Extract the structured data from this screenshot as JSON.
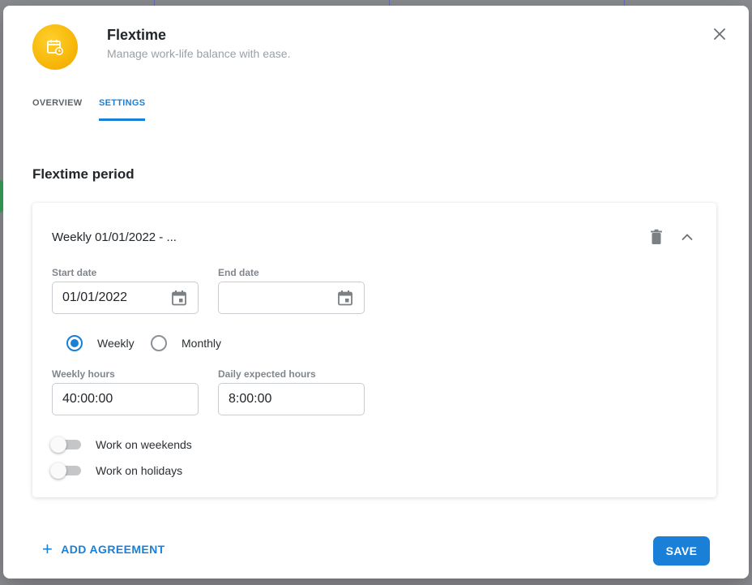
{
  "app": {
    "title": "Flextime",
    "subtitle": "Manage work-life balance with ease.",
    "logo_icon": "calendar-clock-icon",
    "accent": "#1a7fd6",
    "logo_color": "#f7b70a"
  },
  "tabs": [
    {
      "label": "OVERVIEW",
      "active": false
    },
    {
      "label": "SETTINGS",
      "active": true
    }
  ],
  "section": {
    "title": "Flextime period"
  },
  "period": {
    "title": "Weekly 01/01/2022 - ...",
    "start_date": {
      "label": "Start date",
      "value": "01/01/2022"
    },
    "end_date": {
      "label": "End date",
      "value": ""
    },
    "frequency": {
      "options": [
        "Weekly",
        "Monthly"
      ],
      "selected": "Weekly"
    },
    "weekly_hours": {
      "label": "Weekly hours",
      "value": "40:00:00"
    },
    "daily_hours": {
      "label": "Daily expected hours",
      "value": "8:00:00"
    },
    "toggles": [
      {
        "label": "Work on weekends",
        "on": false
      },
      {
        "label": "Work on holidays",
        "on": false
      }
    ]
  },
  "actions": {
    "add_label": "ADD AGREEMENT",
    "save_label": "SAVE"
  }
}
